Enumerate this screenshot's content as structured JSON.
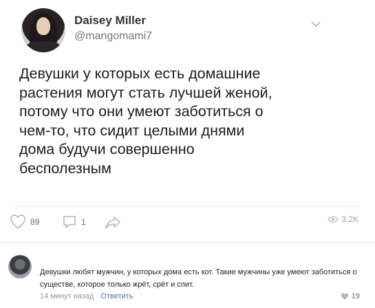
{
  "post": {
    "author_name": "Daisey Miller",
    "author_handle": "@mangomami7",
    "text": "Девушки у которых есть домашние\nрастения могут стать лучшей женой,\nпотому что они умеют заботиться о\nчем-то, что сидит целыми днями\nдома будучи совершенно\nбесполезным",
    "likes": "89",
    "comments": "1",
    "views": "3.2K"
  },
  "comment": {
    "text": "Девушки любят мужчин, у которых дома есть кот. Такие мужчины уже умеют заботиться о существе, которое только жрёт, срёт и спит.",
    "time": "14 минут назад",
    "reply_label": "Ответить",
    "likes": "19"
  },
  "icons": {
    "more": "chevron-down-icon",
    "like": "heart-icon",
    "comment": "comment-icon",
    "share": "share-arrow-icon",
    "views": "eye-icon",
    "comment_like": "heart-icon"
  },
  "colors": {
    "muted_text": "#626d7a",
    "link": "#4d7198",
    "icon_gray": "#aeb7c2"
  }
}
